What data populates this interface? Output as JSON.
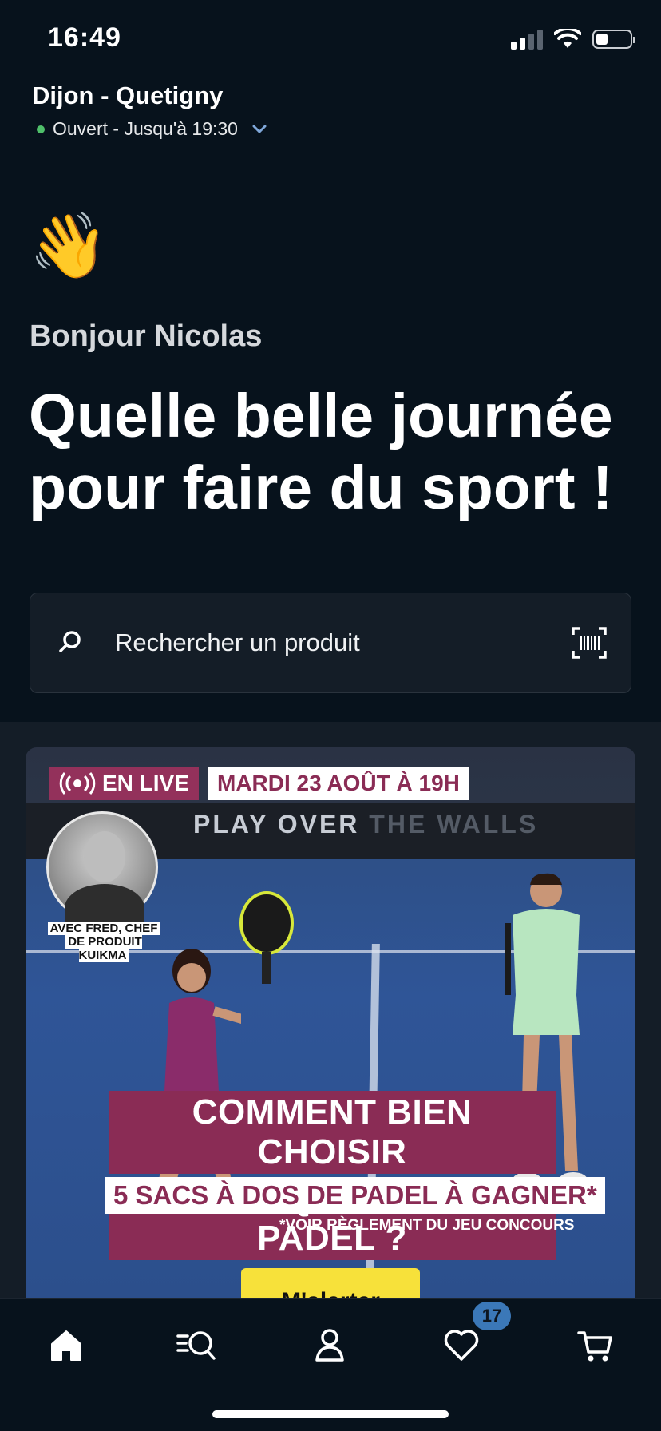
{
  "status_bar": {
    "time": "16:49"
  },
  "store": {
    "name": "Dijon - Quetigny",
    "status": "Ouvert - Jusqu'à 19:30"
  },
  "greeting": {
    "emoji": "👋",
    "hello": "Bonjour Nicolas",
    "headline_line1": "Quelle belle journée",
    "headline_line2": "pour faire du sport !"
  },
  "search": {
    "placeholder": "Rechercher un produit"
  },
  "banner": {
    "live_label": "EN LIVE",
    "date": "MARDI 23 AOÛT À 19H",
    "wall_text_bright": "PLAY OVER",
    "wall_text_dim": "THE WALLS",
    "avatar_caption_line1": "AVEC FRED, CHEF",
    "avatar_caption_line2": "DE PRODUIT KUIKMA",
    "headline_line1": "COMMENT BIEN CHOISIR",
    "headline_line2": "SA RAQUETTE DE PADEL ?",
    "gift": "5 SACS À DOS DE PADEL À GAGNER*",
    "rules": "*VOIR RÈGLEMENT DU JEU CONCOURS",
    "cta": "M'alerter"
  },
  "tab_bar": {
    "items": [
      {
        "icon": "home-icon"
      },
      {
        "icon": "browse-search-icon"
      },
      {
        "icon": "account-icon"
      },
      {
        "icon": "favorites-icon"
      },
      {
        "icon": "cart-icon"
      }
    ],
    "favorites_count": "17"
  },
  "colors": {
    "background": "#07121c",
    "card": "#141d27",
    "brand_magenta": "#8a2c55",
    "cta_yellow": "#f7e13a",
    "badge_blue": "#3b78b8"
  }
}
